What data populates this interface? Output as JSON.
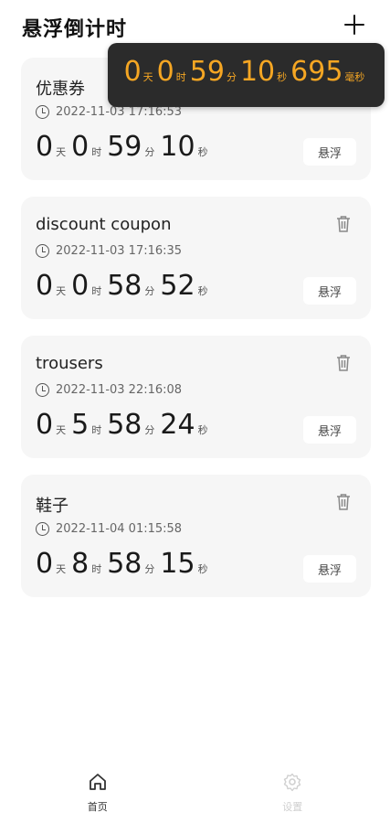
{
  "header": {
    "title": "悬浮倒计时"
  },
  "overlay": {
    "days": "0",
    "hours": "0",
    "minutes": "59",
    "seconds": "10",
    "millis": "695",
    "units": {
      "day": "天",
      "hour": "时",
      "minute": "分",
      "second": "秒",
      "milli": "毫秒"
    }
  },
  "units": {
    "day": "天",
    "hour": "时",
    "minute": "分",
    "second": "秒"
  },
  "float_label": "悬浮",
  "cards": [
    {
      "name": "优惠券",
      "time": "2022-11-03 17:16:53",
      "days": "0",
      "hours": "0",
      "minutes": "59",
      "seconds": "10"
    },
    {
      "name": "discount coupon",
      "time": "2022-11-03 17:16:35",
      "days": "0",
      "hours": "0",
      "minutes": "58",
      "seconds": "52"
    },
    {
      "name": "trousers",
      "time": "2022-11-03 22:16:08",
      "days": "0",
      "hours": "5",
      "minutes": "58",
      "seconds": "24"
    },
    {
      "name": "鞋子",
      "time": "2022-11-04 01:15:58",
      "days": "0",
      "hours": "8",
      "minutes": "58",
      "seconds": "15"
    }
  ],
  "nav": {
    "home": "首页",
    "settings": "设置"
  },
  "colors": {
    "accent": "#f5a623",
    "overlay_bg": "#2b2b2b",
    "card_bg": "#f6f6f6"
  }
}
